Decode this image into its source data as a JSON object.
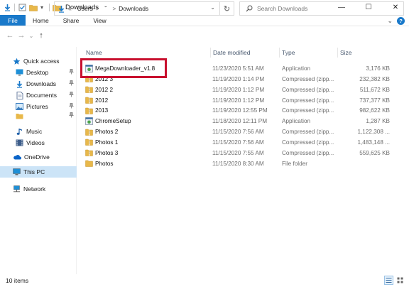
{
  "window": {
    "title": "Downloads",
    "controls": {
      "minimize": "—",
      "maximize": "☐",
      "close": "✕"
    }
  },
  "ribbon": {
    "tabs": [
      "File",
      "Home",
      "Share",
      "View"
    ],
    "collapse_chevron": "⌄",
    "help": "?"
  },
  "address": {
    "back": "←",
    "forward": "→",
    "recent": "⌄",
    "up": "↑",
    "prefix": "«",
    "crumbs": [
      "Users",
      "˘",
      "Downloads"
    ],
    "chevron": ">",
    "dropdown": "⌄",
    "refresh": "↻"
  },
  "search": {
    "placeholder": "Search Downloads"
  },
  "nav": {
    "quick_access": "Quick access",
    "items": [
      {
        "label": "Desktop",
        "icon": "desktop-icon",
        "pinned": true
      },
      {
        "label": "Downloads",
        "icon": "downloads-icon",
        "pinned": true
      },
      {
        "label": "Documents",
        "icon": "documents-icon",
        "pinned": true
      },
      {
        "label": "Pictures",
        "icon": "pictures-icon",
        "pinned": true
      },
      {
        "label": "",
        "icon": "folder-icon",
        "pinned": true
      },
      {
        "label": "Music",
        "icon": "music-icon",
        "pinned": false
      },
      {
        "label": "Videos",
        "icon": "videos-icon",
        "pinned": false
      }
    ],
    "pin_glyph": "📌",
    "onedrive": "OneDrive",
    "thispc": "This PC",
    "network": "Network"
  },
  "columns": {
    "name": "Name",
    "date": "Date modified",
    "type": "Type",
    "size": "Size"
  },
  "files": [
    {
      "name": "MegaDownloader_v1.8",
      "date": "11/23/2020 5:51 AM",
      "type": "Application",
      "size": "3,176 KB",
      "icon": "app-icon"
    },
    {
      "name": "2012 3",
      "date": "11/19/2020 1:14 PM",
      "type": "Compressed (zipp...",
      "size": "232,382 KB",
      "icon": "zip-folder-icon"
    },
    {
      "name": "2012 2",
      "date": "11/19/2020 1:12 PM",
      "type": "Compressed (zipp...",
      "size": "511,672 KB",
      "icon": "zip-folder-icon"
    },
    {
      "name": "2012",
      "date": "11/19/2020 1:12 PM",
      "type": "Compressed (zipp...",
      "size": "737,377 KB",
      "icon": "zip-folder-icon"
    },
    {
      "name": "2013",
      "date": "11/19/2020 12:55 PM",
      "type": "Compressed (zipp...",
      "size": "982,622 KB",
      "icon": "zip-folder-icon"
    },
    {
      "name": "ChromeSetup",
      "date": "11/18/2020 12:11 PM",
      "type": "Application",
      "size": "1,287 KB",
      "icon": "app-icon"
    },
    {
      "name": "Photos 2",
      "date": "11/15/2020 7:56 AM",
      "type": "Compressed (zipp...",
      "size": "1,122,308 ...",
      "icon": "zip-folder-icon"
    },
    {
      "name": "Photos 1",
      "date": "11/15/2020 7:56 AM",
      "type": "Compressed (zipp...",
      "size": "1,483,148 ...",
      "icon": "zip-folder-icon"
    },
    {
      "name": "Photos 3",
      "date": "11/15/2020 7:55 AM",
      "type": "Compressed (zipp...",
      "size": "559,625 KB",
      "icon": "zip-folder-icon"
    },
    {
      "name": "Photos",
      "date": "11/15/2020 8:30 AM",
      "type": "File folder",
      "size": "",
      "icon": "folder-icon"
    }
  ],
  "status": {
    "count": "10 items"
  },
  "colors": {
    "accent": "#1979ca",
    "highlight_box": "#c8102e",
    "selected_bg": "#cce4f7",
    "folder": "#e8b84a"
  }
}
